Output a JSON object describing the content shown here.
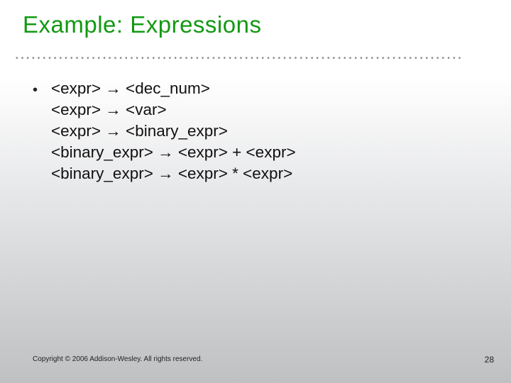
{
  "title": "Example: Expressions",
  "bullet": "•",
  "grammar": {
    "lines": [
      "<expr> → <dec_num>",
      "<expr> → <var>",
      "<expr> → <binary_expr>",
      "<binary_expr> → <expr> + <expr>",
      "<binary_expr> → <expr> * <expr>"
    ]
  },
  "footer": {
    "copyright": "Copyright © 2006 Addison-Wesley. All rights reserved.",
    "page": "28"
  },
  "dots": "••••••••••••••••••••••••••••••••••••••••••••••••••••••••••••••••••••••••••••••••••"
}
